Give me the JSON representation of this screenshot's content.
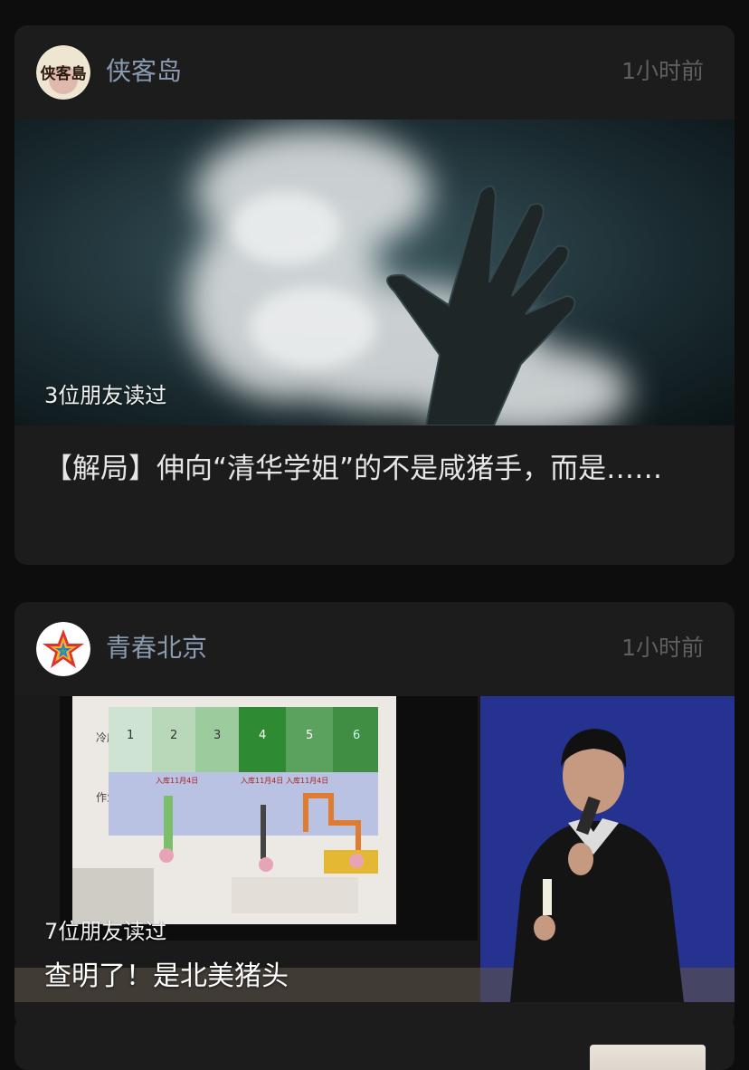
{
  "feed": [
    {
      "source": "侠客岛",
      "avatar_text": "侠客島",
      "time": "1小时前",
      "readers": "3位朋友读过",
      "title": "【解局】伸向“清华学姐”的不是咸猪手，而是……"
    },
    {
      "source": "青春北京",
      "time": "1小时前",
      "readers": "7位朋友读过",
      "overlay_title": "查明了！是北美猪头",
      "slide": {
        "rows": [
          "冷库",
          "作业平台"
        ],
        "numbers": [
          "1",
          "2",
          "3",
          "4",
          "5",
          "6"
        ],
        "labels": [
          "入库11月4日",
          "入库11月4日",
          "入库11月4日"
        ]
      }
    }
  ]
}
